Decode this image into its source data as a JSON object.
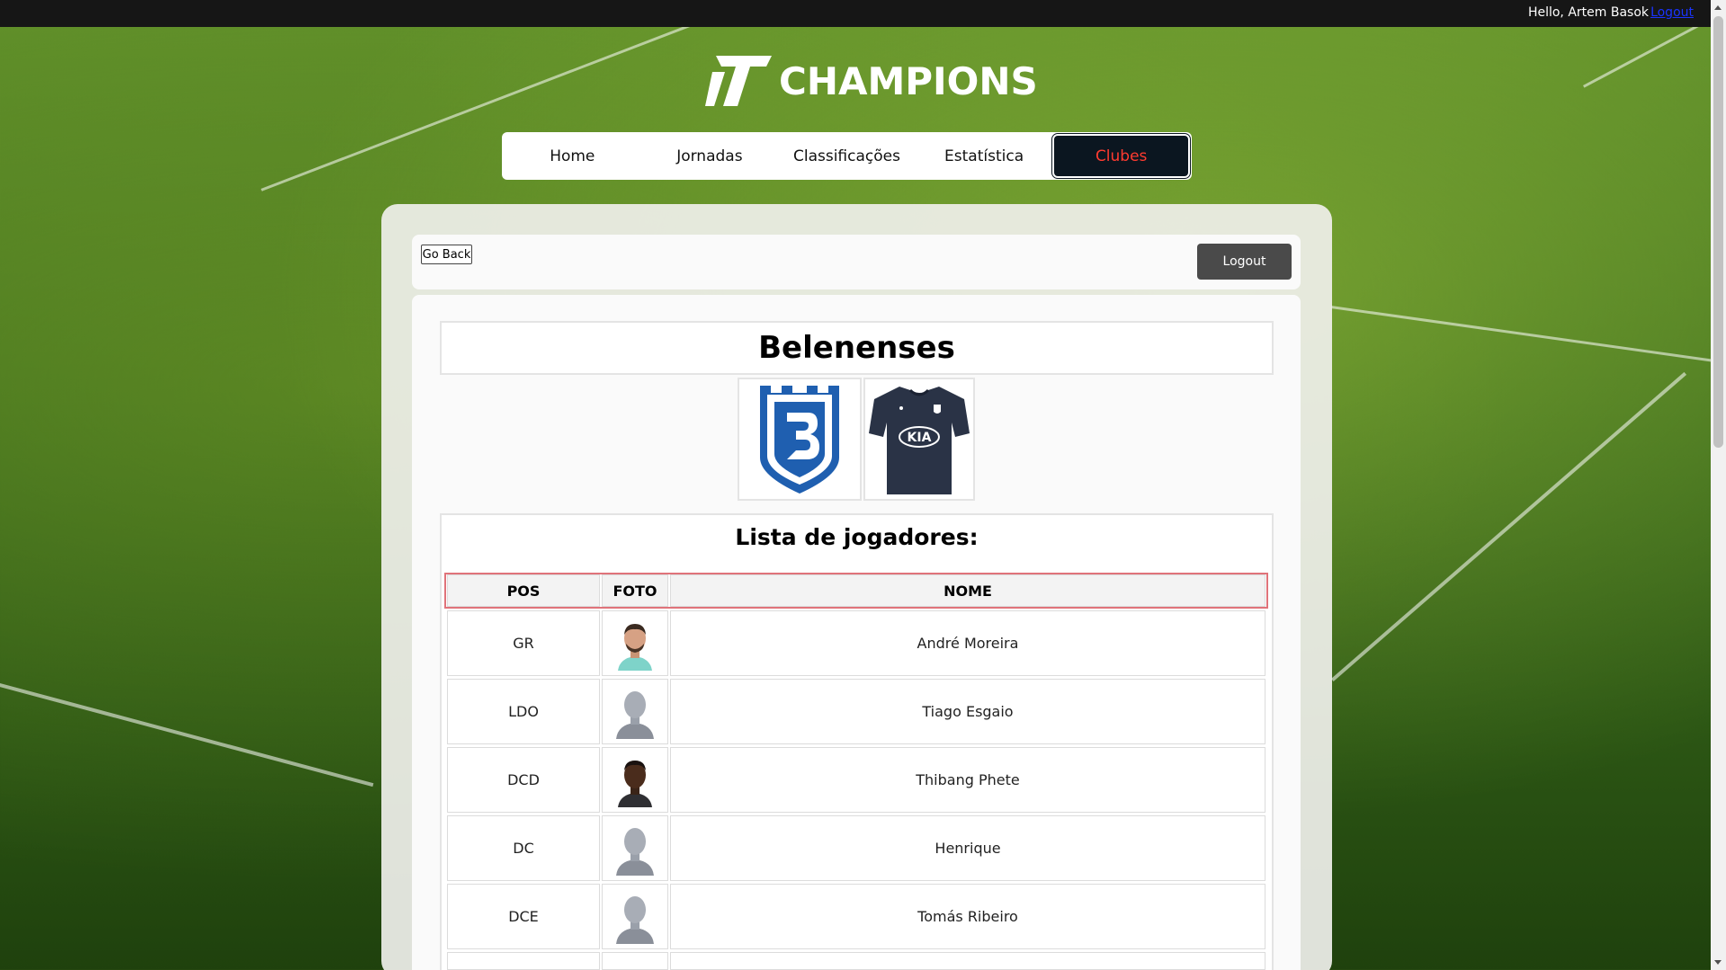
{
  "topbar": {
    "greeting": "Hello, Artem Basok",
    "logout_link": "Logout"
  },
  "logo": {
    "text": "CHAMPIONS"
  },
  "nav": {
    "items": [
      {
        "label": "Home"
      },
      {
        "label": "Jornadas"
      },
      {
        "label": "Classificações"
      },
      {
        "label": "Estatística"
      },
      {
        "label": "Clubes"
      }
    ],
    "active": "Clubes"
  },
  "toolbar": {
    "go_back": "Go Back",
    "logout": "Logout"
  },
  "club": {
    "name": "Belenenses",
    "crest_icon": "belenenses-crest-icon",
    "shirt_icon": "club-shirt-icon",
    "shirt_sponsor": "KIA"
  },
  "players": {
    "title": "Lista de jogadores:",
    "columns": {
      "pos": "POS",
      "foto": "FOTO",
      "nome": "NOME"
    },
    "rows": [
      {
        "pos": "GR",
        "nome": "André Moreira",
        "foto": "player-photo"
      },
      {
        "pos": "LDO",
        "nome": "Tiago Esgaio",
        "foto": "placeholder-silhouette"
      },
      {
        "pos": "DCD",
        "nome": "Thibang Phete",
        "foto": "player-photo"
      },
      {
        "pos": "DC",
        "nome": "Henrique",
        "foto": "placeholder-silhouette"
      },
      {
        "pos": "DCE",
        "nome": "Tomás Ribeiro",
        "foto": "placeholder-silhouette"
      }
    ]
  },
  "colors": {
    "nav_active_bg": "#0b1620",
    "nav_active_text": "#ff3b30",
    "header_border": "#e0737a",
    "link": "#1a34ff",
    "crest_blue": "#1f5fb0",
    "shirt_navy": "#2a3346"
  }
}
